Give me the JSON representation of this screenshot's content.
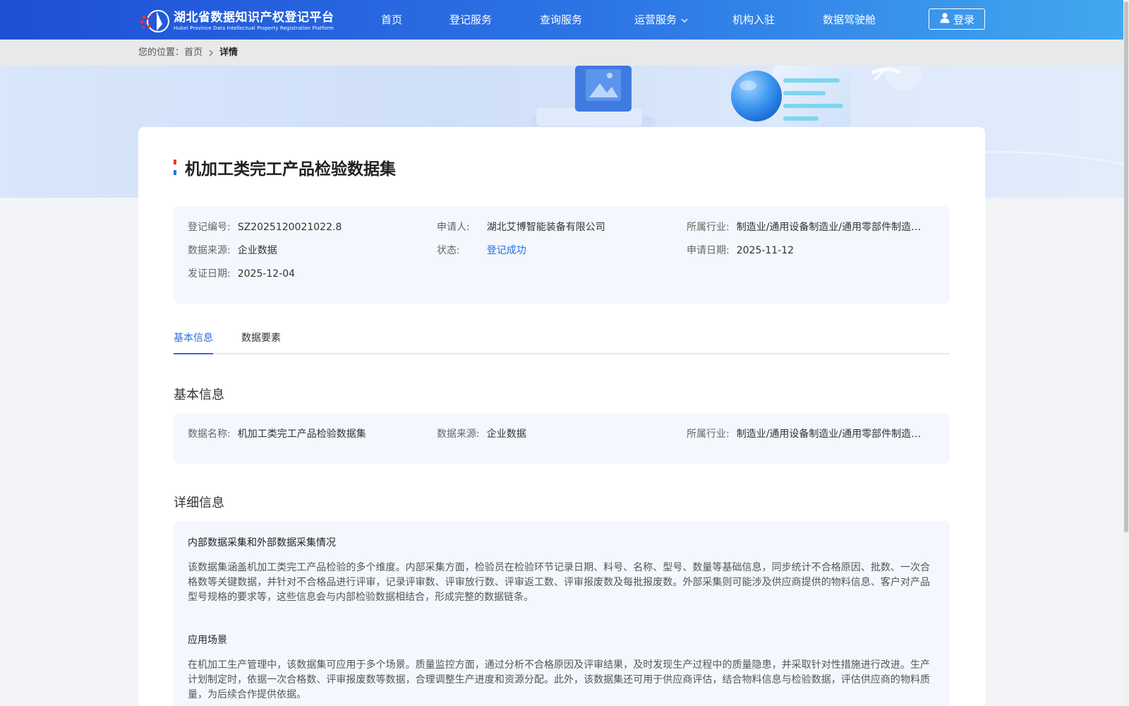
{
  "header": {
    "logo_cn": "湖北省数据知识产权登记平台",
    "logo_en": "Hubei Province Data Intellectual Property Registration Platform",
    "nav": [
      "首页",
      "登记服务",
      "查询服务",
      "运营服务",
      "机构入驻",
      "数据驾驶舱"
    ],
    "login_label": "登录"
  },
  "breadcrumb": {
    "prefix": "您的位置：",
    "home": "首页",
    "current": "详情"
  },
  "title": "机加工类完工产品检验数据集",
  "summary": {
    "reg_no_label": "登记编号:",
    "reg_no": "SZ2025120021022.8",
    "applicant_label": "申请人:",
    "applicant": "湖北艾博智能装备有限公司",
    "industry_label": "所属行业:",
    "industry": "制造业/通用设备制造业/通用零部件制造/其他通用零部件制造",
    "source_label": "数据来源:",
    "source": "企业数据",
    "status_label": "状态:",
    "status": "登记成功",
    "apply_date_label": "申请日期:",
    "apply_date": "2025-11-12",
    "issue_date_label": "发证日期:",
    "issue_date": "2025-12-04"
  },
  "tabs": [
    "基本信息",
    "数据要素"
  ],
  "basic": {
    "section_title": "基本信息",
    "name_label": "数据名称:",
    "name": "机加工类完工产品检验数据集",
    "source_label": "数据来源:",
    "source": "企业数据",
    "industry_label": "所属行业:",
    "industry": "制造业/通用设备制造业/通用零部件制造/其他通用零部件制造"
  },
  "detail": {
    "section_title": "详细信息",
    "collection_title": "内部数据采集和外部数据采集情况",
    "collection_text": "该数据集涵盖机加工类完工产品检验的多个维度。内部采集方面，检验员在检验环节记录日期、料号、名称、型号、数量等基础信息，同步统计不合格原因、批数、一次合格数等关键数据，并针对不合格品进行评审，记录评审数、评审放行数、评审返工数、评审报废数及每批报废数。外部采集则可能涉及供应商提供的物料信息、客户对产品型号规格的要求等，这些信息会与内部检验数据相结合，形成完整的数据链条。",
    "scenario_title": "应用场景",
    "scenario_text": "在机加工生产管理中，该数据集可应用于多个场景。质量监控方面，通过分析不合格原因及评审结果，及时发现生产过程中的质量隐患，并采取针对性措施进行改进。生产计划制定时，依据一次合格数、评审报废数等数据，合理调整生产进度和资源分配。此外，该数据集还可用于供应商评估，结合物料信息与检验数据，评估供应商的物料质量，为后续合作提供依据。"
  },
  "colors": {
    "header_start": "#1e4fd6",
    "header_end": "#41a8ef",
    "accent": "#2a6fe0",
    "status": "#1e6de8",
    "panel_bg": "#f4f7fd"
  }
}
